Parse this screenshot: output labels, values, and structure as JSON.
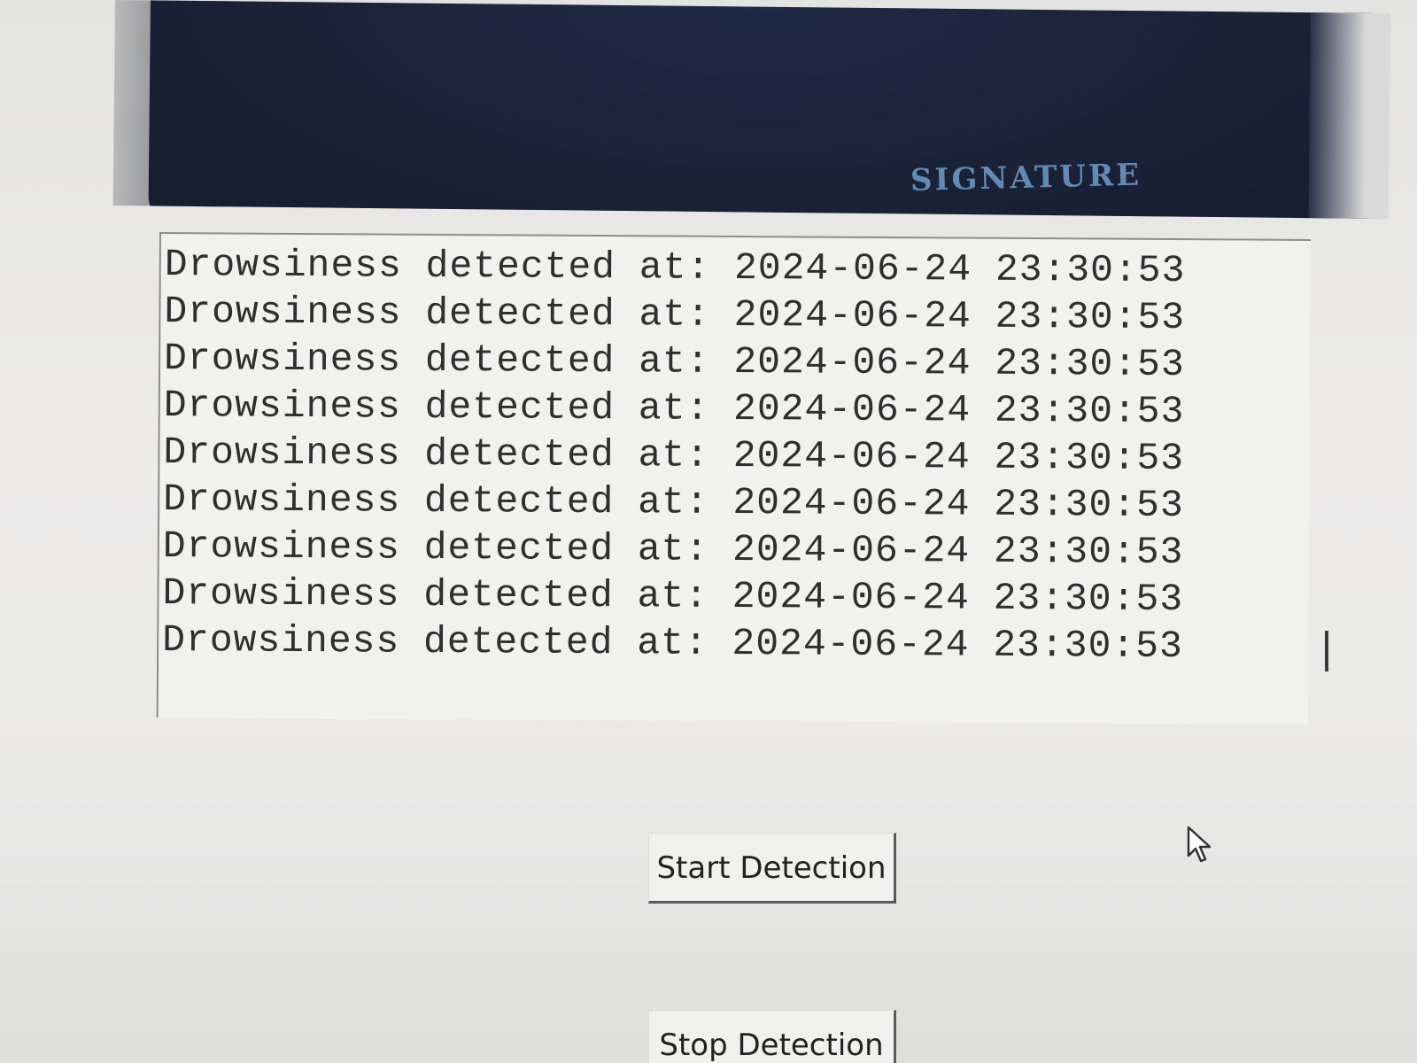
{
  "video_feed": {
    "shirt_print": "SIGNATURE"
  },
  "log": {
    "lines": [
      "Drowsiness detected at: 2024-06-24 23:30:53",
      "Drowsiness detected at: 2024-06-24 23:30:53",
      "Drowsiness detected at: 2024-06-24 23:30:53",
      "Drowsiness detected at: 2024-06-24 23:30:53",
      "Drowsiness detected at: 2024-06-24 23:30:53",
      "Drowsiness detected at: 2024-06-24 23:30:53",
      "Drowsiness detected at: 2024-06-24 23:30:53",
      "Drowsiness detected at: 2024-06-24 23:30:53",
      "Drowsiness detected at: 2024-06-24 23:30:53"
    ]
  },
  "controls": {
    "start_label": "Start Detection",
    "stop_label": "Stop Detection"
  },
  "icons": {
    "pointer": "mouse-pointer-icon",
    "text_cursor": "text-cursor-icon"
  }
}
